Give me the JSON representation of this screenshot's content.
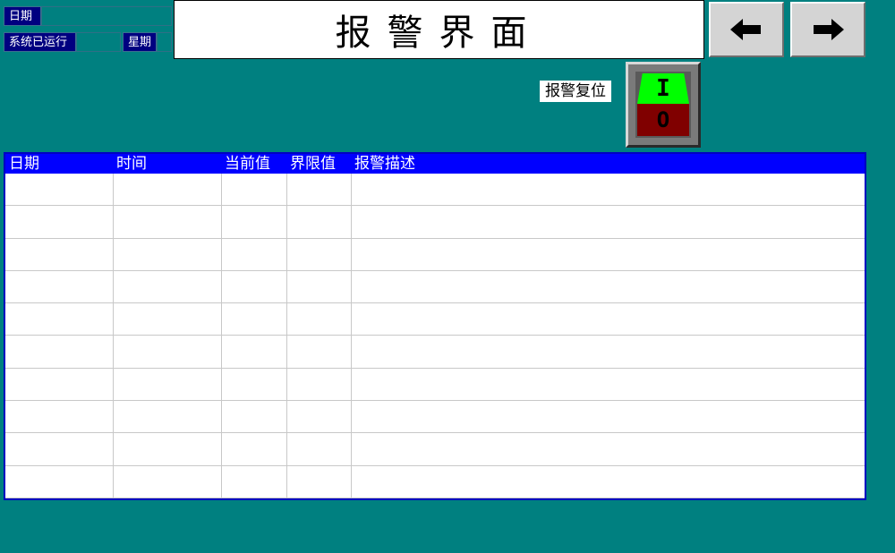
{
  "status": {
    "date_label": "日期",
    "date_value": "",
    "runtime_label": "系统已运行",
    "runtime_value": "",
    "weekday_label": "星期",
    "weekday_value": ""
  },
  "header": {
    "title": "报警界面"
  },
  "nav": {
    "back_icon": "arrow-left-icon",
    "forward_icon": "arrow-right-icon"
  },
  "reset": {
    "label": "报警复位",
    "on_text": "I",
    "off_text": "O",
    "on_color": "#00ff00",
    "off_color": "#800000"
  },
  "alarm_table": {
    "columns": [
      "日期",
      "时间",
      "当前值",
      "界限值",
      "报警描述"
    ],
    "rows": [
      [
        "",
        "",
        "",
        "",
        ""
      ],
      [
        "",
        "",
        "",
        "",
        ""
      ],
      [
        "",
        "",
        "",
        "",
        ""
      ],
      [
        "",
        "",
        "",
        "",
        ""
      ],
      [
        "",
        "",
        "",
        "",
        ""
      ],
      [
        "",
        "",
        "",
        "",
        ""
      ],
      [
        "",
        "",
        "",
        "",
        ""
      ],
      [
        "",
        "",
        "",
        "",
        ""
      ],
      [
        "",
        "",
        "",
        "",
        ""
      ],
      [
        "",
        "",
        "",
        "",
        ""
      ]
    ]
  },
  "colors": {
    "background": "#008080",
    "header_blue": "#0000ff",
    "label_navy": "#000080"
  }
}
